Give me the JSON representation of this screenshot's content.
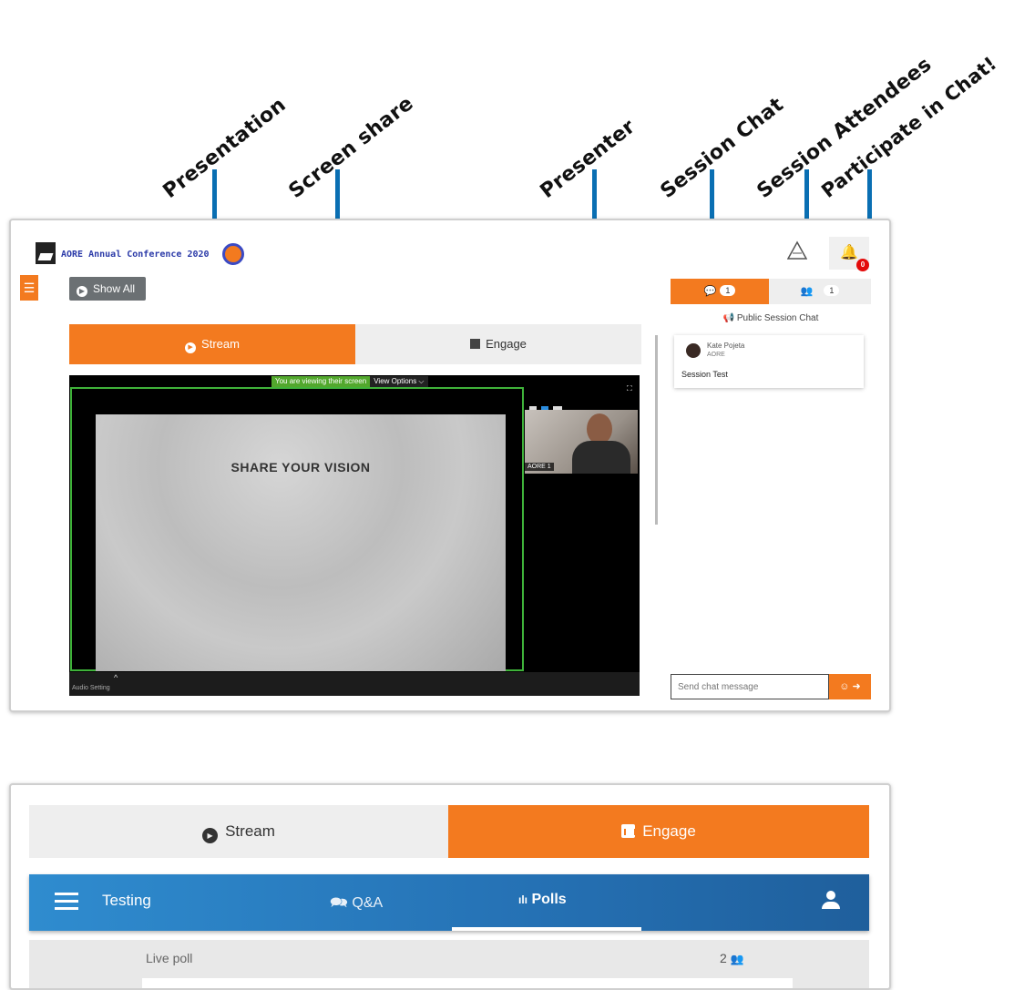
{
  "callouts": {
    "presentation": "Presentation",
    "screen_share": "Screen share",
    "presenter": "Presenter",
    "session_chat": "Session Chat",
    "session_attendees": "Session Attendees",
    "participate": "Participate in Chat!"
  },
  "header": {
    "conference_title": "AORE Annual Conference 2020",
    "notification_count": "0"
  },
  "toolbar": {
    "show_all": "Show All"
  },
  "top_tabs": {
    "stream": "Stream",
    "engage": "Engage"
  },
  "video": {
    "viewing_notice": "You are viewing their screen",
    "view_options": "View Options ⌵",
    "slide_title": "SHARE YOUR VISION",
    "presenter_label": "AORE 1",
    "audio_setting": "Audio Setting"
  },
  "chat": {
    "chat_count": "1",
    "attendee_count": "1",
    "public_label": "Public Session Chat",
    "message": {
      "name": "Kate Pojeta",
      "org": "AORE",
      "text": "Session Test"
    },
    "input_placeholder": "Send chat message"
  },
  "engage_panel": {
    "stream_tab": "Stream",
    "engage_tab": "Engage",
    "app_title": "Testing",
    "qa_tab": "Q&A",
    "polls_tab": "Polls",
    "live_poll_label": "Live poll",
    "live_poll_count": "2"
  },
  "colors": {
    "accent_orange": "#f37a1f",
    "arrow_blue": "#0a6fb3",
    "app_bar_blue": "#2571b4"
  }
}
